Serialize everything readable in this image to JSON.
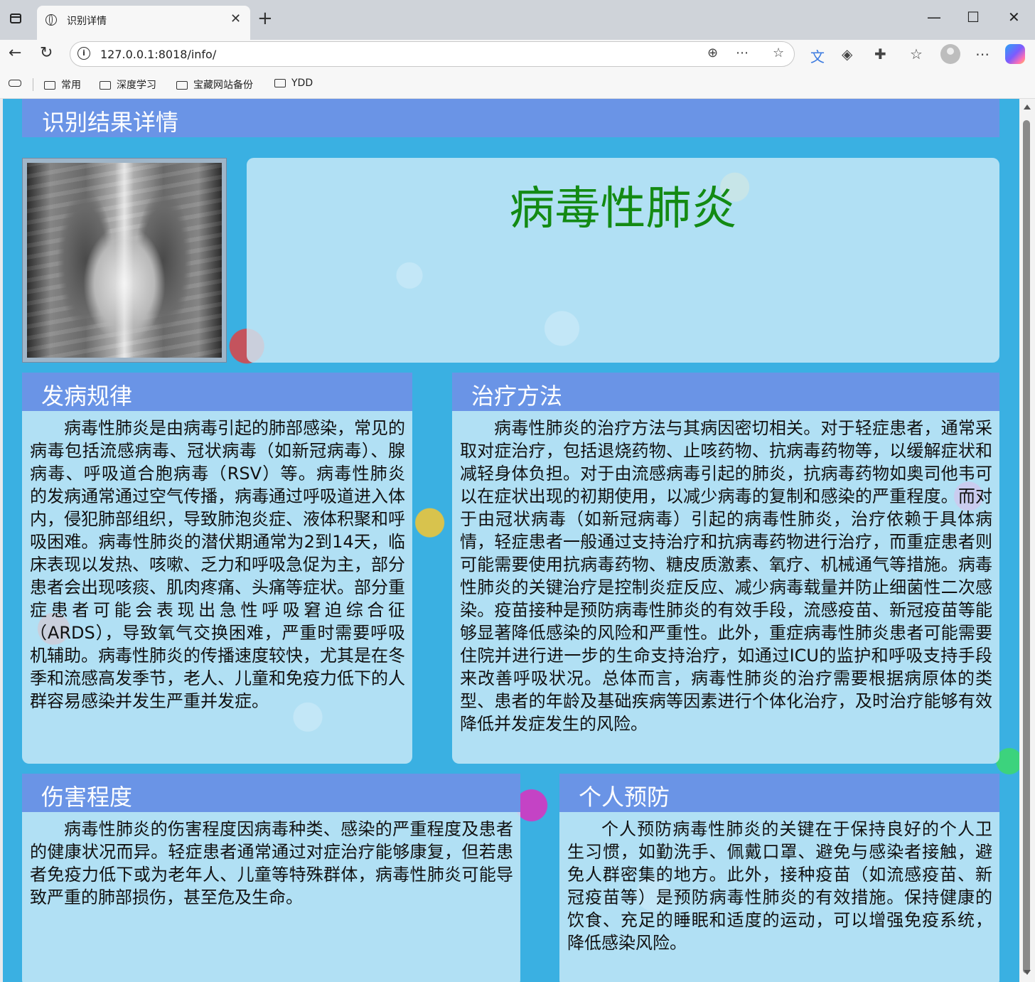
{
  "browser": {
    "tab_title": "识别详情",
    "tab_close": "✕",
    "new_tab": "+",
    "url": "127.0.0.1:8018/info/",
    "minimize": "—",
    "maximize": "☐",
    "close": "✕",
    "bookmarks": [
      "常用",
      "深度学习",
      "宝藏网站备份",
      "YDD"
    ]
  },
  "page": {
    "header_title": "识别结果详情",
    "result": "病毒性肺炎",
    "result_color": "#138a13",
    "accent": "#6a94e6",
    "cards": {
      "pathogenesis": {
        "title": "发病规律",
        "text": "病毒性肺炎是由病毒引起的肺部感染，常见的病毒包括流感病毒、冠状病毒（如新冠病毒）、腺病毒、呼吸道合胞病毒（RSV）等。病毒性肺炎的发病通常通过空气传播，病毒通过呼吸道进入体内，侵犯肺部组织，导致肺泡炎症、液体积聚和呼吸困难。病毒性肺炎的潜伏期通常为2到14天，临床表现以发热、咳嗽、乏力和呼吸急促为主，部分患者会出现咳痰、肌肉疼痛、头痛等症状。部分重症患者可能会表现出急性呼吸窘迫综合征（ARDS），导致氧气交换困难，严重时需要呼吸机辅助。病毒性肺炎的传播速度较快，尤其是在冬季和流感高发季节，老人、儿童和免疫力低下的人群容易感染并发生严重并发症。"
      },
      "treatment": {
        "title": "治疗方法",
        "text": "病毒性肺炎的治疗方法与其病因密切相关。对于轻症患者，通常采取对症治疗，包括退烧药物、止咳药物、抗病毒药物等，以缓解症状和减轻身体负担。对于由流感病毒引起的肺炎，抗病毒药物如奥司他韦可以在症状出现的初期使用，以减少病毒的复制和感染的严重程度。而对于由冠状病毒（如新冠病毒）引起的病毒性肺炎，治疗依赖于具体病情，轻症患者一般通过支持治疗和抗病毒药物进行治疗，而重症患者则可能需要使用抗病毒药物、糖皮质激素、氧疗、机械通气等措施。病毒性肺炎的关键治疗是控制炎症反应、减少病毒载量并防止细菌性二次感染。疫苗接种是预防病毒性肺炎的有效手段，流感疫苗、新冠疫苗等能够显著降低感染的风险和严重性。此外，重症病毒性肺炎患者可能需要住院并进行进一步的生命支持治疗，如通过ICU的监护和呼吸支持手段来改善呼吸状况。总体而言，病毒性肺炎的治疗需要根据病原体的类型、患者的年龄及基础疾病等因素进行个体化治疗，及时治疗能够有效降低并发症发生的风险。"
      },
      "harm": {
        "title": "伤害程度",
        "text": "病毒性肺炎的伤害程度因病毒种类、感染的严重程度及患者的健康状况而异。轻症患者通常通过对症治疗能够康复，但若患者免疫力低下或为老年人、儿童等特殊群体，病毒性肺炎可能导致严重的肺部损伤，甚至危及生命。"
      },
      "prevention": {
        "title": "个人预防",
        "text": "个人预防病毒性肺炎的关键在于保持良好的个人卫生习惯，如勤洗手、佩戴口罩、避免与感染者接触，避免人群密集的地方。此外，接种疫苗（如流感疫苗、新冠疫苗等）是预防病毒性肺炎的有效措施。保持健康的饮食、充足的睡眠和适度的运动，可以增强免疫系统，降低感染风险。"
      }
    }
  }
}
